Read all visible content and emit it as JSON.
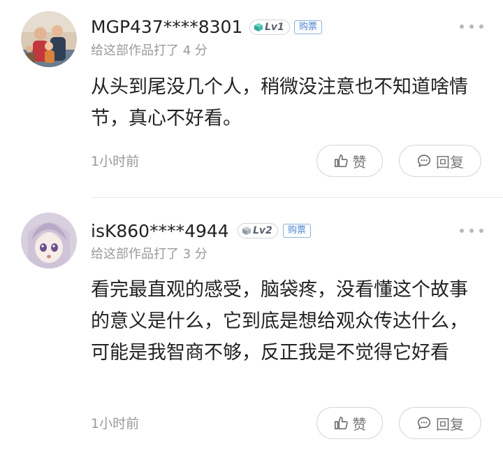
{
  "comments": [
    {
      "username": "MGP437****8301",
      "level": "Lv1",
      "purchase_badge": "购票",
      "rating_text": "给这部作品打了 4 分",
      "text": "从头到尾没几个人，稍微没注意也不知道啥情节，真心不好看。",
      "time": "1小时前",
      "like_label": "赞",
      "reply_label": "回复",
      "level_icon": "cube-icon",
      "level_icon_color": "#3bb7a6"
    },
    {
      "username": "isK860****4944",
      "level": "Lv2",
      "purchase_badge": "购票",
      "rating_text": "给这部作品打了 3 分",
      "text": "看完最直观的感受，脑袋疼，没看懂这个故事的意义是什么，它到底是想给观众传达什么，可能是我智商不够，反正我是不觉得它好看",
      "time": "1小时前",
      "like_label": "赞",
      "reply_label": "回复",
      "level_icon": "cube-icon",
      "level_icon_color": "#9aa3ad"
    }
  ]
}
